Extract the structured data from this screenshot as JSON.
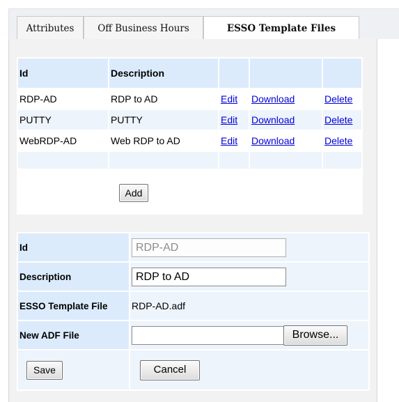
{
  "tabs": [
    {
      "label": "Attributes",
      "active": false
    },
    {
      "label": "Off Business Hours",
      "active": false
    },
    {
      "label": "ESSO Template Files",
      "active": true
    }
  ],
  "files_table": {
    "headers": {
      "id": "Id",
      "description": "Description"
    },
    "rows": [
      {
        "id": "RDP-AD",
        "description": "RDP to AD",
        "edit": "Edit",
        "download": "Download",
        "delete": "Delete"
      },
      {
        "id": "PUTTY",
        "description": "PUTTY",
        "edit": "Edit",
        "download": "Download",
        "delete": "Delete"
      },
      {
        "id": "WebRDP-AD",
        "description": "Web RDP to AD",
        "edit": "Edit",
        "download": "Download",
        "delete": "Delete"
      }
    ],
    "add_label": "Add"
  },
  "form": {
    "id_label": "Id",
    "id_value": "RDP-AD",
    "description_label": "Description",
    "description_value": "RDP to AD",
    "template_file_label": "ESSO Template File",
    "template_file_value": "RDP-AD.adf",
    "new_adf_label": "New ADF File",
    "new_adf_value": "",
    "browse_label": "Browse...",
    "save_label": "Save",
    "cancel_label": "Cancel"
  },
  "colors": {
    "header_bg": "#dcebfc",
    "alt_row_bg": "#eef4fc",
    "link": "#0000d8",
    "tabbar_bg": "#eef0f3"
  }
}
